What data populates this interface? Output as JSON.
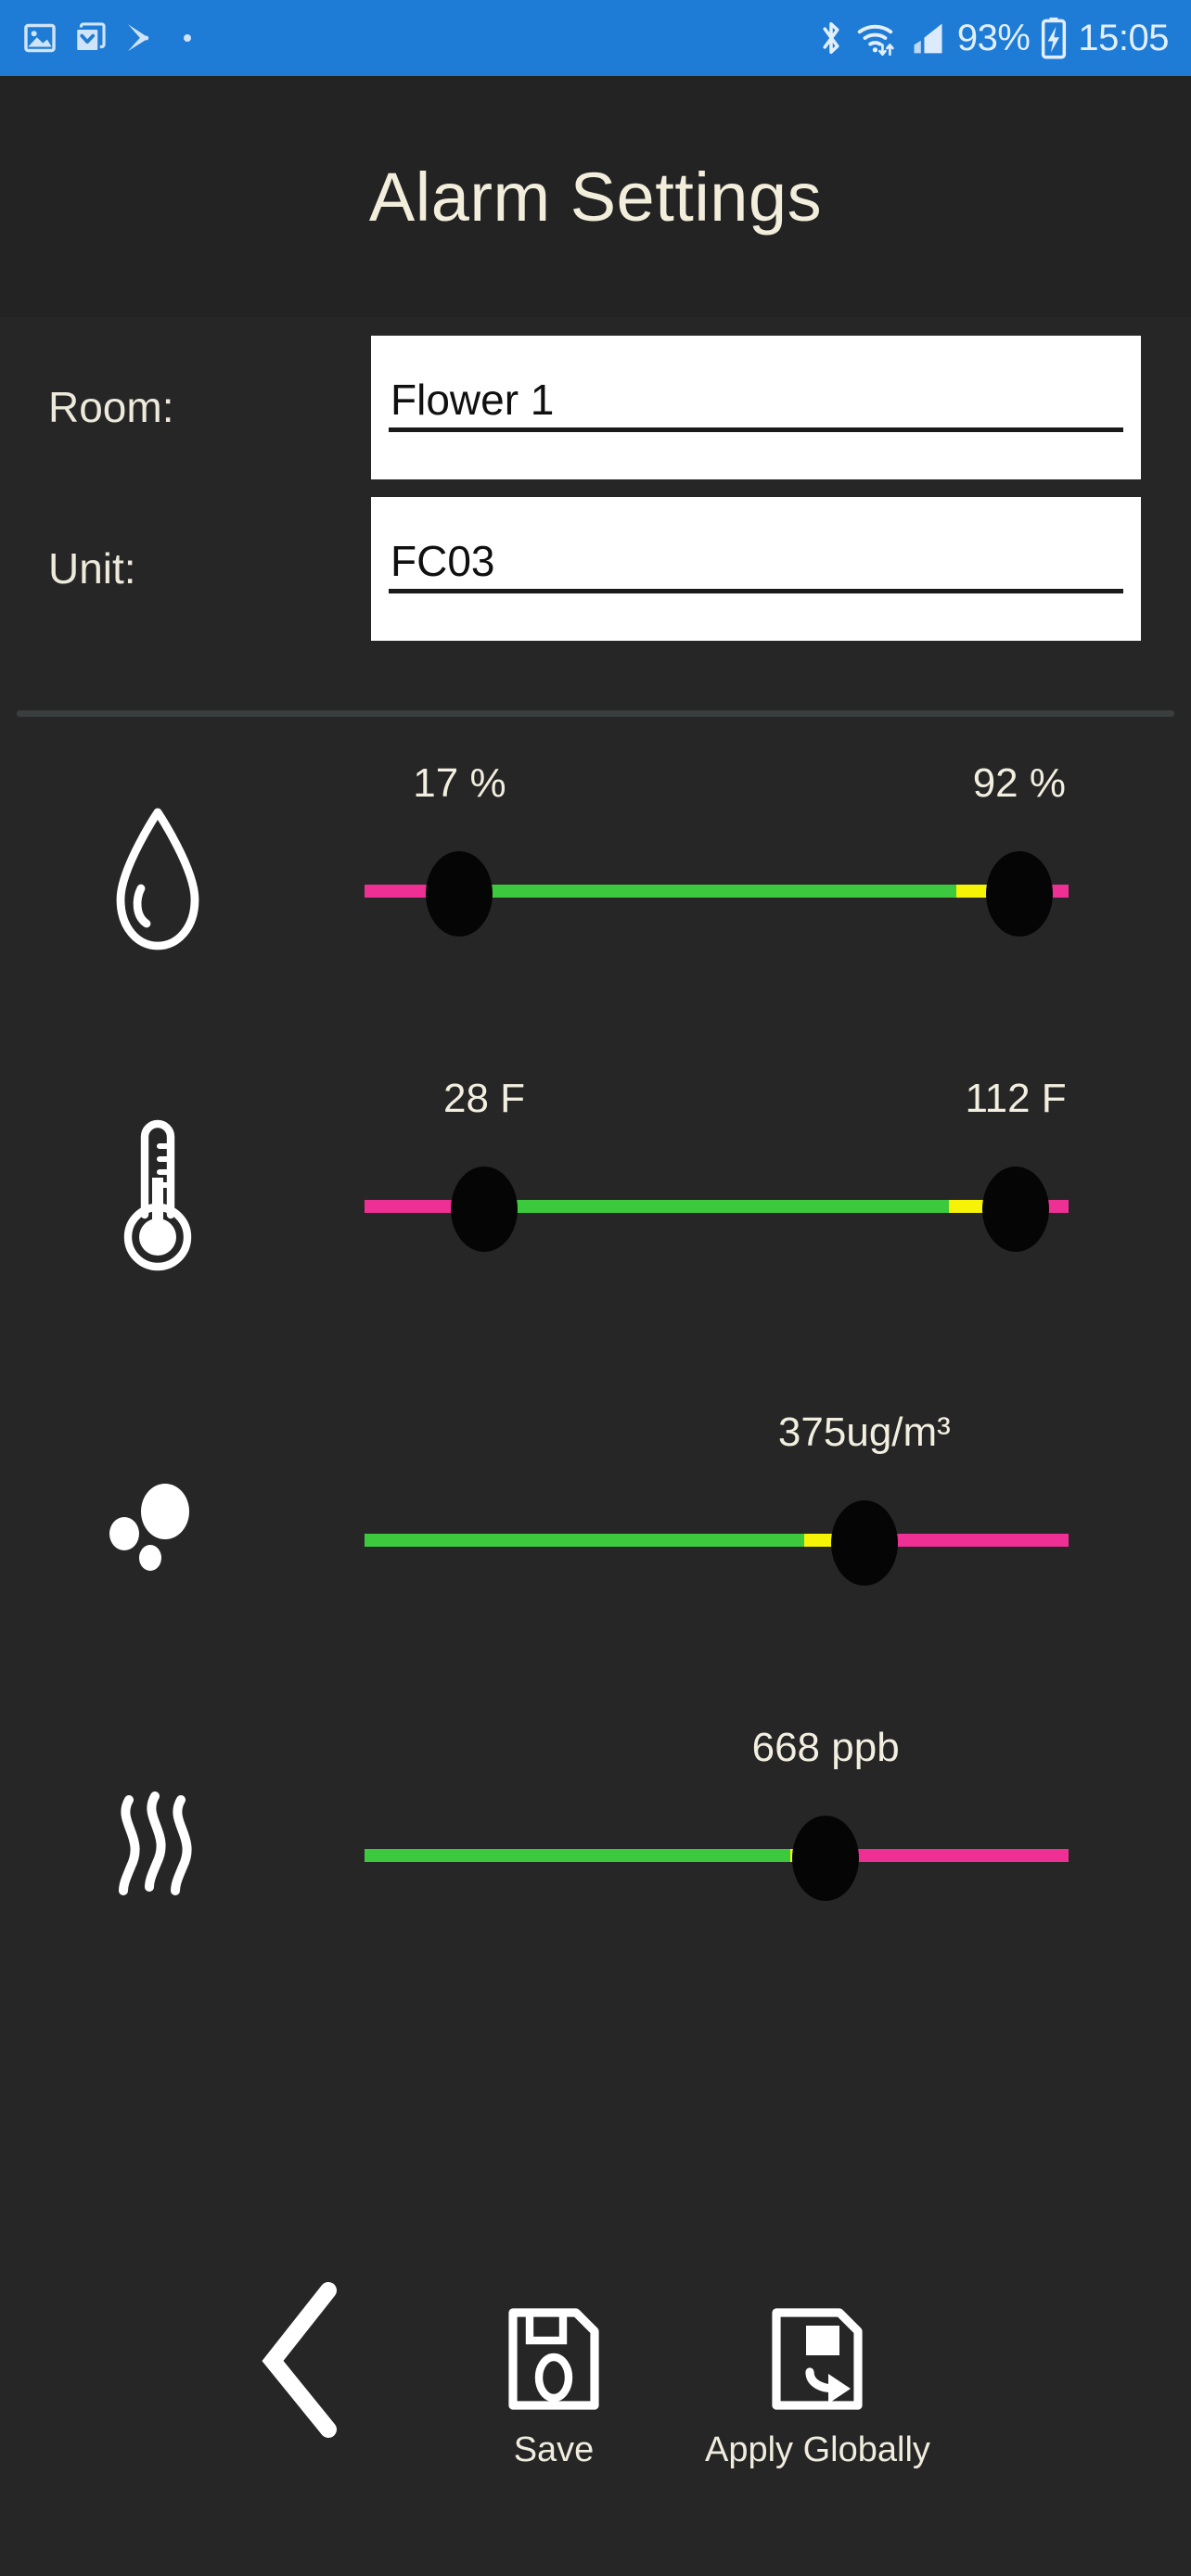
{
  "statusbar": {
    "left_icons": [
      "screenshot-icon",
      "inbox-download-icon",
      "play-store-icon",
      "dot-indicator"
    ],
    "right_icons": [
      "bluetooth-icon",
      "wifi-icon",
      "cell-signal-icon",
      "battery-charging-icon"
    ],
    "battery_percent": "93%",
    "time": "15:05",
    "background_color": "#1E7BD6",
    "foreground_color": "#E2EFFB"
  },
  "header": {
    "title": "Alarm Settings"
  },
  "form": {
    "fields": [
      {
        "label": "Room:",
        "value": "Flower 1"
      },
      {
        "label": "Unit:",
        "value": "FC03"
      }
    ]
  },
  "colors": {
    "page_background": "#262626",
    "text": "#F2EFE0",
    "safe_green": "#3DC93D",
    "warn_yellow": "#F6F306",
    "alarm_pink": "#EE3095",
    "thumb": "#050505"
  },
  "sliders": [
    {
      "name": "humidity",
      "icon": "water-drop-icon",
      "type": "range",
      "unit": "%",
      "low_label": "17 %",
      "high_label": "92 %",
      "low_value": 17,
      "high_value": 92,
      "low_pos_pct": 13.5,
      "high_pos_pct": 93.0,
      "segments": [
        {
          "color": "alarm_pink",
          "width_pct": 13.5
        },
        {
          "color": "safe_green",
          "width_pct": 70.5
        },
        {
          "color": "warn_yellow",
          "width_pct": 9.0
        },
        {
          "color": "alarm_pink",
          "width_pct": 7.0
        }
      ]
    },
    {
      "name": "temperature",
      "icon": "thermometer-icon",
      "type": "range",
      "unit": "F",
      "low_label": "28 F",
      "high_label": "112 F",
      "low_value": 28,
      "high_value": 112,
      "low_pos_pct": 17.0,
      "high_pos_pct": 92.5,
      "segments": [
        {
          "color": "alarm_pink",
          "width_pct": 17.0
        },
        {
          "color": "safe_green",
          "width_pct": 66.0
        },
        {
          "color": "warn_yellow",
          "width_pct": 11.5
        },
        {
          "color": "alarm_pink",
          "width_pct": 5.5
        }
      ]
    },
    {
      "name": "particulate-matter",
      "icon": "particles-icon",
      "type": "single",
      "unit": "ug/m³",
      "value_label": "375ug/m³",
      "value": 375,
      "thumb_pos_pct": 71.0,
      "segments": [
        {
          "color": "safe_green",
          "width_pct": 62.5
        },
        {
          "color": "warn_yellow",
          "width_pct": 8.5
        },
        {
          "color": "alarm_pink",
          "width_pct": 29.0
        }
      ]
    },
    {
      "name": "voc",
      "icon": "vapor-waves-icon",
      "type": "single",
      "unit": "ppb",
      "value_label": "668  ppb",
      "value": 668,
      "thumb_pos_pct": 65.5,
      "segments": [
        {
          "color": "safe_green",
          "width_pct": 60.5
        },
        {
          "color": "warn_yellow",
          "width_pct": 5.5
        },
        {
          "color": "alarm_pink",
          "width_pct": 34.0
        }
      ]
    }
  ],
  "bottombar": {
    "back": {
      "icon": "back-chevron-icon",
      "label": ""
    },
    "save": {
      "icon": "save-floppy-icon",
      "label": "Save"
    },
    "apply": {
      "icon": "apply-globally-icon",
      "label": "Apply Globally"
    }
  }
}
